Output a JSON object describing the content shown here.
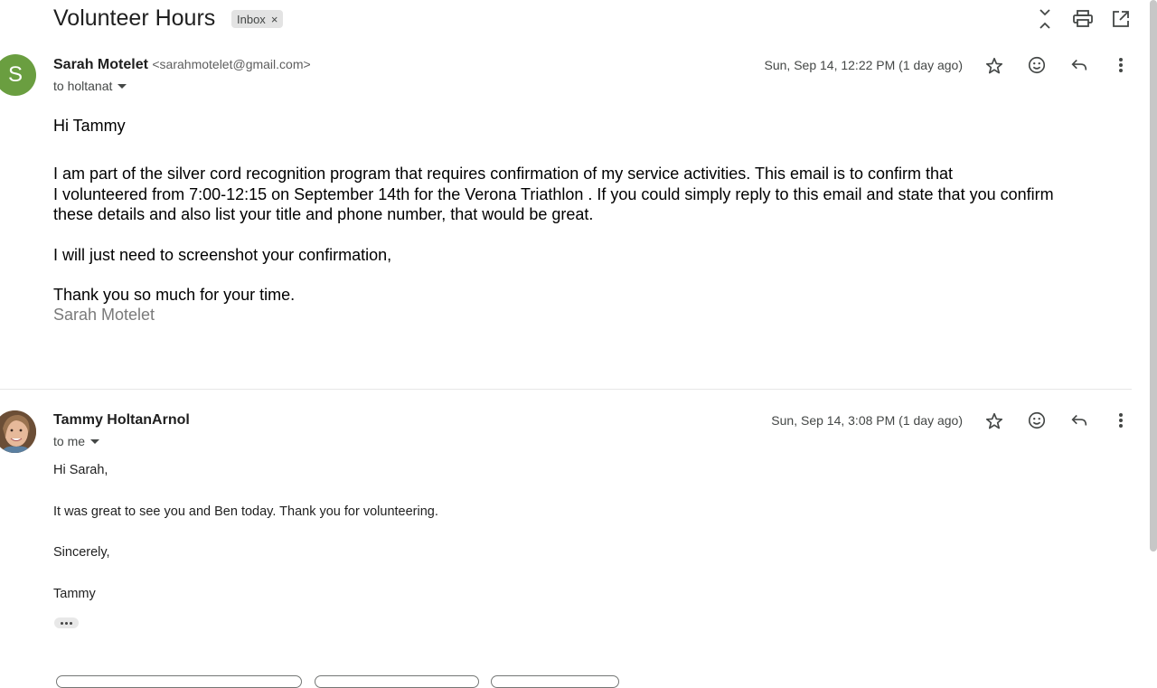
{
  "thread": {
    "subject": "Volunteer Hours",
    "label_chip": "Inbox",
    "label_remove": "×"
  },
  "message1": {
    "avatar_letter": "S",
    "avatar_color": "#6a9e40",
    "sender_name": "Sarah Motelet",
    "sender_email": "<sarahmotelet@gmail.com>",
    "to": "to holtanat",
    "date": "Sun, Sep 14, 12:22 PM (1 day ago)",
    "greeting": "Hi Tammy",
    "para1_line1": "I am part of the silver cord recognition program that requires confirmation of my service activities. This email is to confirm that",
    "para1_line2": "I volunteered from 7:00-12:15  on September 14th for the Verona Triathlon . If you could simply reply to this email and state that you confirm",
    "para1_line3": "these details and also list your title and phone number, that would be great.",
    "para2": "I will just need to screenshot your confirmation,",
    "closing": "Thank you so much for your time.",
    "signature": "Sarah Motelet"
  },
  "message2": {
    "sender_name": "Tammy HoltanArnol",
    "to": "to me",
    "date": "Sun, Sep 14, 3:08 PM (1 day ago)",
    "greeting": "Hi Sarah,",
    "line1": "It was great to see you and Ben today. Thank you for volunteering.",
    "closing": "Sincerely,",
    "name": "Tammy"
  },
  "icons": {
    "collapse": "collapse-all-icon",
    "print": "print-icon",
    "open_new": "open-in-new-window-icon",
    "star": "star-icon",
    "emoji": "emoji-reaction-icon",
    "reply": "reply-icon",
    "more": "more-vert-icon",
    "show_trimmed": "show-trimmed-content-icon"
  }
}
